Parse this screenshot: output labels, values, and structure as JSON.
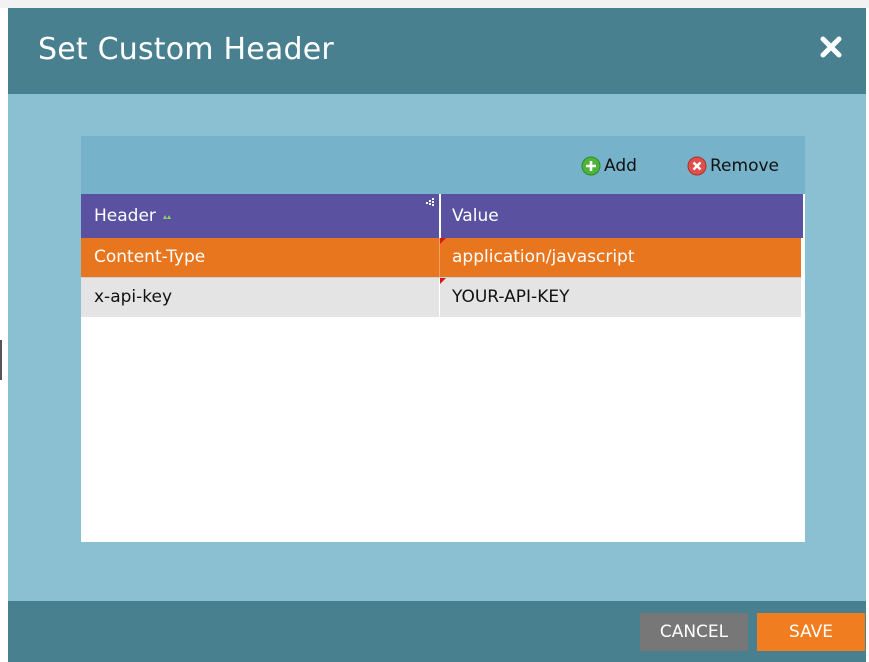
{
  "dialog": {
    "title": "Set Custom Header",
    "close_icon": "close-icon"
  },
  "toolbar": {
    "add_label": "Add",
    "add_icon": "plus-circle-icon",
    "remove_label": "Remove",
    "remove_icon": "x-circle-icon"
  },
  "grid": {
    "columns": [
      "Header",
      "Value"
    ],
    "sort_icon": "sort-arrows-icon",
    "rows": [
      {
        "header": "Content-Type",
        "value": "application/javascript",
        "selected": true
      },
      {
        "header": "x-api-key",
        "value": "YOUR-API-KEY",
        "selected": false
      }
    ]
  },
  "footer": {
    "cancel_label": "CANCEL",
    "save_label": "SAVE"
  },
  "colors": {
    "titlebar": "#48808f",
    "dialog_body": "#8bc0d3",
    "toolbar": "#76b2c9",
    "grid_header": "#5b51a1",
    "selected_row": "#e8761f",
    "save_button": "#f07d1f",
    "cancel_button": "#777777"
  }
}
